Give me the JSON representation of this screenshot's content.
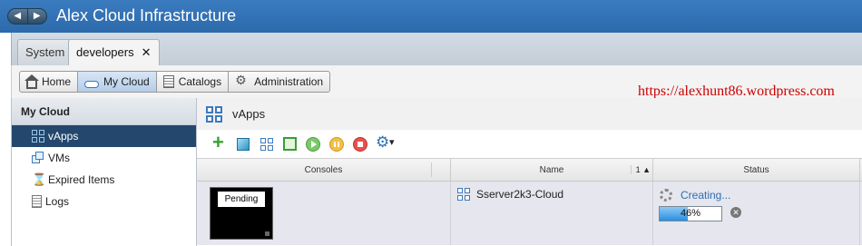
{
  "app": {
    "title": "Alex Cloud Infrastructure",
    "nav_back": "◀",
    "nav_forward": "▶"
  },
  "org_tabs": [
    {
      "label": "System"
    },
    {
      "label": "developers",
      "close": "✕"
    }
  ],
  "main_nav": [
    {
      "label": "Home",
      "icon": "home-icon"
    },
    {
      "label": "My Cloud",
      "icon": "cloud-icon",
      "active": true
    },
    {
      "label": "Catalogs",
      "icon": "catalog-icon"
    },
    {
      "label": "Administration",
      "icon": "admin-icon"
    }
  ],
  "watermark": "https://alexhunt86.wordpress.com",
  "sidebar": {
    "title": "My Cloud",
    "items": [
      {
        "label": "vApps",
        "icon": "vapps-icon",
        "active": true
      },
      {
        "label": "VMs",
        "icon": "vms-icon"
      },
      {
        "label": "Expired Items",
        "icon": "hourglass-icon"
      },
      {
        "label": "Logs",
        "icon": "logs-icon"
      }
    ]
  },
  "content": {
    "title": "vApps",
    "toolbar": [
      "add-icon",
      "cube-icon",
      "new-vapp-icon",
      "box-icon",
      "play-icon",
      "pause-icon",
      "stop-icon",
      "gear-icon"
    ],
    "table": {
      "columns": {
        "consoles": "Consoles",
        "name": "Name",
        "status": "Status",
        "sort": "1 ▲"
      },
      "rows": [
        {
          "console": "Pending",
          "name": "Sserver2k3-Cloud",
          "status": "Creating...",
          "progress_percent": 46,
          "progress_label": "46%"
        }
      ]
    }
  },
  "colors": {
    "titlebar": "#3175b5",
    "sidebar_active": "#24476d",
    "watermark": "#cc0000",
    "status_text": "#2f6fb5"
  }
}
